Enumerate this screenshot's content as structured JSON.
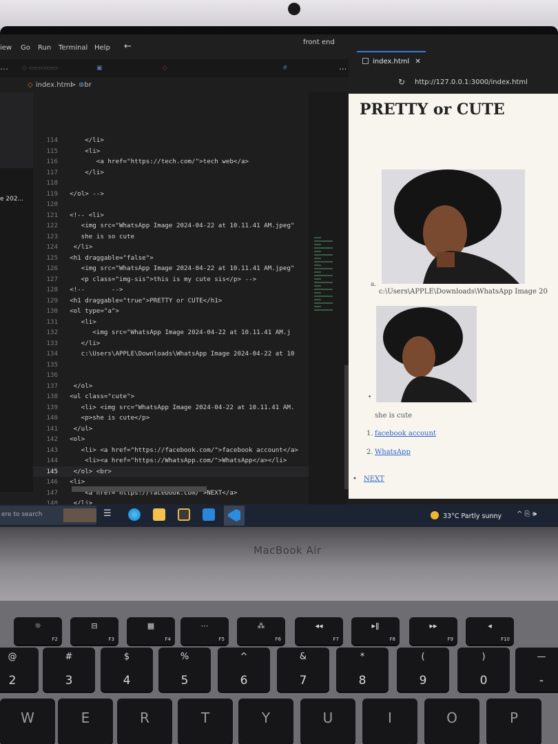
{
  "device": {
    "brand": "MacBook Air"
  },
  "menubar": {
    "items": [
      "iew",
      "Go",
      "Run",
      "Terminal",
      "Help"
    ],
    "window_title": "front end"
  },
  "editor": {
    "more_label": "...",
    "breadcrumb": {
      "file": "index.html",
      "separator": ">",
      "node": "br"
    },
    "explorer_label": "e 202...",
    "lines": [
      {
        "num": "114",
        "text": "      </li>"
      },
      {
        "num": "115",
        "text": "      <li>"
      },
      {
        "num": "116",
        "text": "         <a href=\"https://tech.com/\">tech web</a>"
      },
      {
        "num": "117",
        "text": "      </li>"
      },
      {
        "num": "118",
        "text": ""
      },
      {
        "num": "119",
        "text": "  </ol> -->"
      },
      {
        "num": "120",
        "text": ""
      },
      {
        "num": "121",
        "text": "  <!-- <li>"
      },
      {
        "num": "122",
        "text": "     <img src=\"WhatsApp Image 2024-04-22 at 10.11.41 AM.jpeg\""
      },
      {
        "num": "123",
        "text": "     she is so cute"
      },
      {
        "num": "124",
        "text": "   </li>"
      },
      {
        "num": "125",
        "text": "  <h1 draggable=\"false\">"
      },
      {
        "num": "126",
        "text": "     <img src=\"WhatsApp Image 2024-04-22 at 10.11.41 AM.jpeg\""
      },
      {
        "num": "127",
        "text": "     <p class=\"img-sis\">this is my cute sis</p> -->"
      },
      {
        "num": "128",
        "text": "  <!--       -->"
      },
      {
        "num": "129",
        "text": "  <h1 draggable=\"true\">PRETTY or CUTE</h1>"
      },
      {
        "num": "130",
        "text": "  <ol type=\"a\">"
      },
      {
        "num": "131",
        "text": "     <li>"
      },
      {
        "num": "132",
        "text": "        <img src=\"WhatsApp Image 2024-04-22 at 10.11.41 AM.j"
      },
      {
        "num": "133",
        "text": "     </li>"
      },
      {
        "num": "134",
        "text": "     c:\\Users\\APPLE\\Downloads\\WhatsApp Image 2024-04-22 at 10"
      },
      {
        "num": "135",
        "text": ""
      },
      {
        "num": "136",
        "text": ""
      },
      {
        "num": "137",
        "text": "   </ol>"
      },
      {
        "num": "138",
        "text": "  <ul class=\"cute\">"
      },
      {
        "num": "139",
        "text": "     <li> <img src=\"WhatsApp Image 2024-04-22 at 10.11.41 AM."
      },
      {
        "num": "140",
        "text": "     <p>she is cute</p>"
      },
      {
        "num": "141",
        "text": "   </ul>"
      },
      {
        "num": "142",
        "text": "  <ol>"
      },
      {
        "num": "143",
        "text": "     <li> <a href=\"https://facebook.com/\">facebook account</a>"
      },
      {
        "num": "144",
        "text": "      <li><a href=\"https://WhatsApp.com/\">WhatsApp</a></li>"
      },
      {
        "num": "145",
        "text": "   </ol> <br>"
      },
      {
        "num": "146",
        "text": "  <li>"
      },
      {
        "num": "147",
        "text": "      <a href=\"https://facebook.com/\">NEXT</a>"
      },
      {
        "num": "148",
        "text": "   </li>"
      }
    ],
    "current_line": "145"
  },
  "preview": {
    "tab_label": "index.html",
    "close_glyph": "✕",
    "url": "http://127.0.0.1:3000/index.html",
    "title": "PRETTY or CUTE",
    "ol_marker": "a.",
    "path_text": "c:\\Users\\APPLE\\Downloads\\WhatsApp Image 20",
    "ul_marker": "•",
    "caption": "she is cute",
    "links": [
      {
        "num": "1.",
        "label": "facebook account"
      },
      {
        "num": "2.",
        "label": "WhatsApp"
      }
    ],
    "next_bullet": "•",
    "next_label": "NEXT"
  },
  "taskbar": {
    "search_placeholder": "ere to search",
    "weather": "33°C  Partly sunny",
    "tray": "^ ⎘ 🕪"
  },
  "keyboard": {
    "fn_row": [
      {
        "fn": "F2",
        "icon": "☼"
      },
      {
        "fn": "F3",
        "icon": "⊟"
      },
      {
        "fn": "F4",
        "icon": "▦"
      },
      {
        "fn": "F5",
        "icon": "⋯"
      },
      {
        "fn": "F6",
        "icon": "⁂"
      },
      {
        "fn": "F7",
        "icon": "◂◂"
      },
      {
        "fn": "F8",
        "icon": "▸ǁ"
      },
      {
        "fn": "F9",
        "icon": "▸▸"
      },
      {
        "fn": "F10",
        "icon": "◂"
      }
    ],
    "number_row": [
      {
        "top": "@",
        "bot": "2"
      },
      {
        "top": "#",
        "bot": "3"
      },
      {
        "top": "$",
        "bot": "4"
      },
      {
        "top": "%",
        "bot": "5"
      },
      {
        "top": "^",
        "bot": "6"
      },
      {
        "top": "&",
        "bot": "7"
      },
      {
        "top": "*",
        "bot": "8"
      },
      {
        "top": "(",
        "bot": "9"
      },
      {
        "top": ")",
        "bot": "0"
      },
      {
        "top": "—",
        "bot": "-"
      }
    ],
    "letter_row": [
      "W",
      "E",
      "R",
      "T",
      "Y",
      "U",
      "I",
      "O",
      "P"
    ]
  }
}
